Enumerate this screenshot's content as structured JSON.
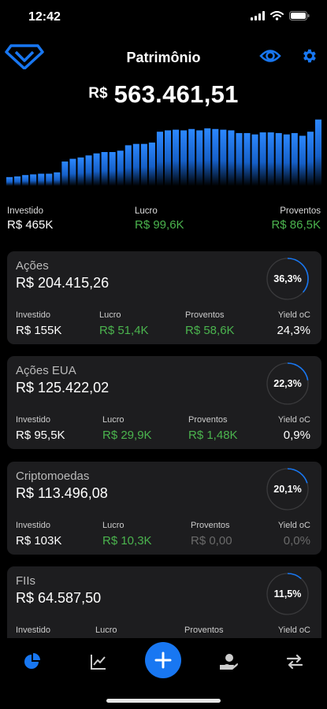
{
  "status": {
    "time": "12:42"
  },
  "header": {
    "title": "Patrimônio"
  },
  "total": {
    "currency": "R$",
    "value": "563.461,51"
  },
  "history_bars": [
    0.13,
    0.14,
    0.16,
    0.17,
    0.18,
    0.18,
    0.2,
    0.36,
    0.4,
    0.42,
    0.45,
    0.48,
    0.5,
    0.5,
    0.52,
    0.6,
    0.62,
    0.62,
    0.64,
    0.8,
    0.82,
    0.83,
    0.82,
    0.84,
    0.82,
    0.85,
    0.84,
    0.83,
    0.82,
    0.78,
    0.78,
    0.76,
    0.79,
    0.79,
    0.78,
    0.76,
    0.78,
    0.74,
    0.8,
    0.98
  ],
  "colors": {
    "accent": "#1877f2",
    "positive": "#4bb44e",
    "card": "#1d1d1f",
    "muted": "#6a6a6a"
  },
  "summary": {
    "invested_label": "Investido",
    "invested_value": "R$ 465K",
    "profit_label": "Lucro",
    "profit_value": "R$ 99,6K",
    "income_label": "Proventos",
    "income_value": "R$ 86,5K"
  },
  "cards": [
    {
      "name": "Ações",
      "value": "R$ 204.415,26",
      "percent": "36,3%",
      "share": 0.363,
      "invested_label": "Investido",
      "invested": "R$ 155K",
      "profit_label": "Lucro",
      "profit": "R$ 51,4K",
      "income_label": "Proventos",
      "income": "R$ 58,6K",
      "yield_label": "Yield oC",
      "yield": "24,3%"
    },
    {
      "name": "Ações EUA",
      "value": "R$ 125.422,02",
      "percent": "22,3%",
      "share": 0.223,
      "invested_label": "Investido",
      "invested": "R$ 95,5K",
      "profit_label": "Lucro",
      "profit": "R$ 29,9K",
      "income_label": "Proventos",
      "income": "R$ 1,48K",
      "yield_label": "Yield oC",
      "yield": "0,9%"
    },
    {
      "name": "Criptomoedas",
      "value": "R$ 113.496,08",
      "percent": "20,1%",
      "share": 0.201,
      "invested_label": "Investido",
      "invested": "R$ 103K",
      "profit_label": "Lucro",
      "profit": "R$ 10,3K",
      "income_label": "Proventos",
      "income": "R$ 0,00",
      "yield_label": "Yield oC",
      "yield": "0,0%"
    },
    {
      "name": "FIIs",
      "value": "R$ 64.587,50",
      "percent": "11,5%",
      "share": 0.115,
      "invested_label": "Investido",
      "invested": "",
      "profit_label": "Lucro",
      "profit": "",
      "income_label": "Proventos",
      "income": "",
      "yield_label": "Yield oC",
      "yield": ""
    }
  ],
  "tabs": [
    {
      "icon": "pie-chart-icon",
      "active": true
    },
    {
      "icon": "line-chart-icon",
      "active": false
    },
    {
      "icon": "plus-icon",
      "active": false
    },
    {
      "icon": "hand-money-icon",
      "active": false
    },
    {
      "icon": "transfer-arrows-icon",
      "active": false
    }
  ]
}
